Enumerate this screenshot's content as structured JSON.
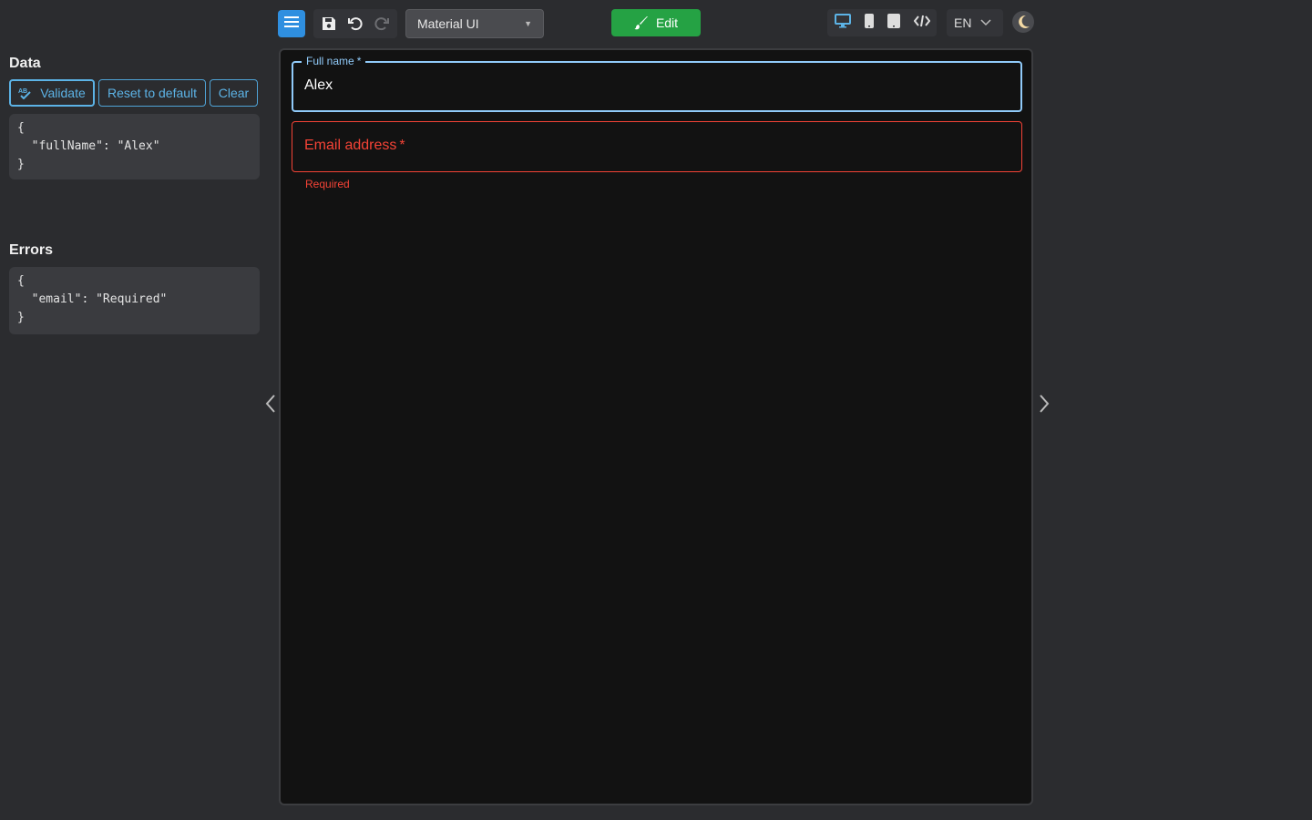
{
  "toolbar": {
    "theme_select_value": "Material UI",
    "edit_label": "Edit",
    "language_value": "EN"
  },
  "data_panel": {
    "title": "Data",
    "validate_label": "Validate",
    "reset_label": "Reset to default",
    "clear_label": "Clear",
    "json_text": "{\n  \"fullName\": \"Alex\"\n}"
  },
  "errors_panel": {
    "title": "Errors",
    "json_text": "{\n  \"email\": \"Required\"\n}"
  },
  "form": {
    "full_name_label": "Full name",
    "full_name_value": "Alex",
    "email_label": "Email address",
    "required_marker": "*",
    "email_helper": "Required"
  },
  "colors": {
    "accent": "#2f8fe0",
    "edit_green": "#25a244",
    "focus_blue": "#90caf9",
    "error_red": "#f44336"
  },
  "icons": [
    "menu-icon",
    "save-icon",
    "undo-icon",
    "redo-icon",
    "brush-icon",
    "desktop-icon",
    "mobile-icon",
    "tablet-icon",
    "code-icon",
    "chevron-down-icon",
    "moon-icon",
    "spellcheck-icon",
    "chevron-left-icon",
    "chevron-right-icon"
  ]
}
